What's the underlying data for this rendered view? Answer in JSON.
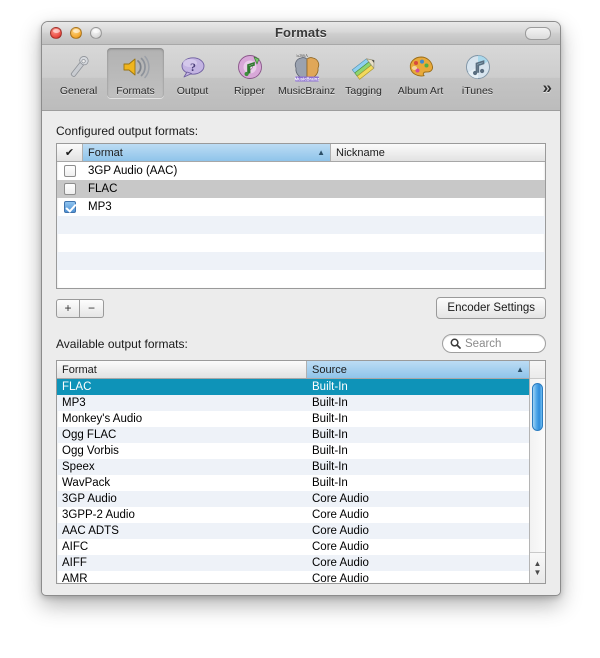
{
  "window": {
    "title": "Formats",
    "controls": {
      "close": "close",
      "minimize": "minimize",
      "zoom": "zoom"
    }
  },
  "toolbar": {
    "items": [
      {
        "label": "General",
        "icon": "wrench-icon",
        "selected": false
      },
      {
        "label": "Formats",
        "icon": "speaker-icon",
        "selected": true
      },
      {
        "label": "Output",
        "icon": "question-bubble-icon",
        "selected": false
      },
      {
        "label": "Ripper",
        "icon": "cd-note-icon",
        "selected": false
      },
      {
        "label": "MusicBrainz",
        "icon": "brain-icon",
        "selected": false
      },
      {
        "label": "Tagging",
        "icon": "pencil-icon",
        "selected": false
      },
      {
        "label": "Album Art",
        "icon": "palette-icon",
        "selected": false
      },
      {
        "label": "iTunes",
        "icon": "itunes-cd-icon",
        "selected": false
      }
    ],
    "overflow": "»"
  },
  "configured": {
    "label": "Configured output formats:",
    "columns": {
      "check": "✔",
      "format": "Format",
      "nickname": "Nickname"
    },
    "sort_column": "Format",
    "sort_arrow": "▲",
    "rows": [
      {
        "checked": false,
        "format": "3GP Audio (AAC)",
        "nickname": "",
        "selected": false
      },
      {
        "checked": false,
        "format": "FLAC",
        "nickname": "",
        "selected": true
      },
      {
        "checked": true,
        "format": "MP3",
        "nickname": "",
        "selected": false
      }
    ],
    "empty_rows": 4,
    "add_label": "+",
    "remove_label": "−",
    "encoder_settings_label": "Encoder Settings"
  },
  "available": {
    "label": "Available output formats:",
    "search_placeholder": "Search",
    "search_value": "",
    "columns": {
      "format": "Format",
      "source": "Source"
    },
    "sort_column": "Source",
    "sort_arrow": "▲",
    "rows": [
      {
        "format": "FLAC",
        "source": "Built-In",
        "selected": true
      },
      {
        "format": "MP3",
        "source": "Built-In",
        "selected": false
      },
      {
        "format": "Monkey's Audio",
        "source": "Built-In",
        "selected": false
      },
      {
        "format": "Ogg FLAC",
        "source": "Built-In",
        "selected": false
      },
      {
        "format": "Ogg Vorbis",
        "source": "Built-In",
        "selected": false
      },
      {
        "format": "Speex",
        "source": "Built-In",
        "selected": false
      },
      {
        "format": "WavPack",
        "source": "Built-In",
        "selected": false
      },
      {
        "format": "3GP Audio",
        "source": "Core Audio",
        "selected": false
      },
      {
        "format": "3GPP-2 Audio",
        "source": "Core Audio",
        "selected": false
      },
      {
        "format": "AAC ADTS",
        "source": "Core Audio",
        "selected": false
      },
      {
        "format": "AIFC",
        "source": "Core Audio",
        "selected": false
      },
      {
        "format": "AIFF",
        "source": "Core Audio",
        "selected": false
      },
      {
        "format": "AMR",
        "source": "Core Audio",
        "selected": false
      }
    ],
    "scroll_up_arrow": "▲",
    "scroll_down_arrow": "▼"
  },
  "colors": {
    "selection_teal": "#0e93b8",
    "header_blue": "#8fc4ea",
    "checkbox_blue": "#4f92d4",
    "row_stripe": "#eef2f8",
    "window_bg": "#ececec"
  }
}
